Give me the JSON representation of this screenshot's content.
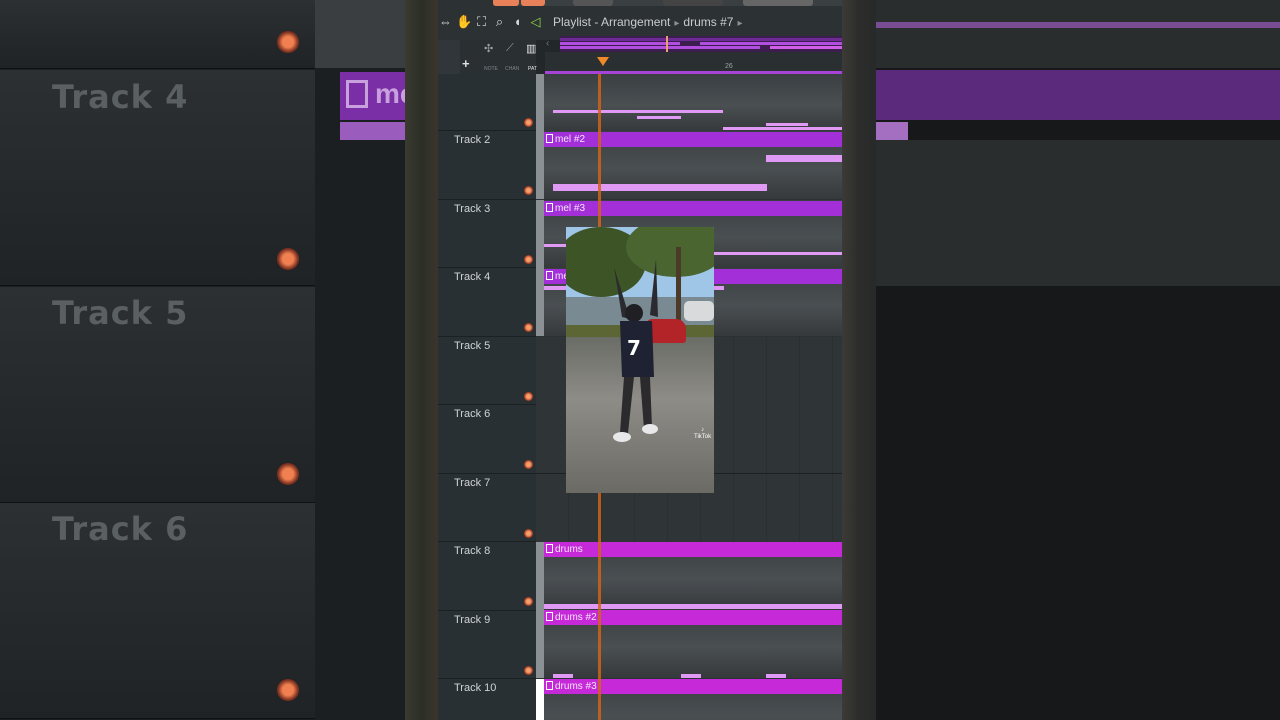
{
  "window": {
    "title": "Playlist",
    "title_parts": [
      "Playlist - Arrangement",
      "drums #7"
    ]
  },
  "toolbar": {
    "tools": [
      "playback-icon",
      "hand-icon",
      "select-icon",
      "zoom-icon",
      "mute-icon"
    ],
    "speaker_icon": "speaker-icon"
  },
  "header": {
    "add_label": "+",
    "mini_labels": [
      "NOTE",
      "CHAN",
      "PAT"
    ]
  },
  "ruler": {
    "bar_number": "26"
  },
  "background": {
    "track_names": [
      "Track 4",
      "Track 5",
      "Track 6"
    ],
    "clip_label": "mel"
  },
  "tracks": [
    {
      "name": "",
      "clip": ""
    },
    {
      "name": "Track 2",
      "clip": "mel #2"
    },
    {
      "name": "Track 3",
      "clip": "mel #3"
    },
    {
      "name": "Track 4",
      "clip": "me"
    },
    {
      "name": "Track 5",
      "clip": ""
    },
    {
      "name": "Track 6",
      "clip": ""
    },
    {
      "name": "Track 7",
      "clip": ""
    },
    {
      "name": "Track 8",
      "clip": "drums"
    },
    {
      "name": "Track 9",
      "clip": "drums #2"
    },
    {
      "name": "Track 10",
      "clip": "drums #3"
    }
  ],
  "overlay": {
    "watermark": "TikTok",
    "jersey_number": "7"
  },
  "colors": {
    "clip_purple": "#a32fd9",
    "clip_magenta": "#c62ad8",
    "note_pink": "#e09af6",
    "playhead": "#d06418",
    "accent_green": "#8ed44a"
  }
}
